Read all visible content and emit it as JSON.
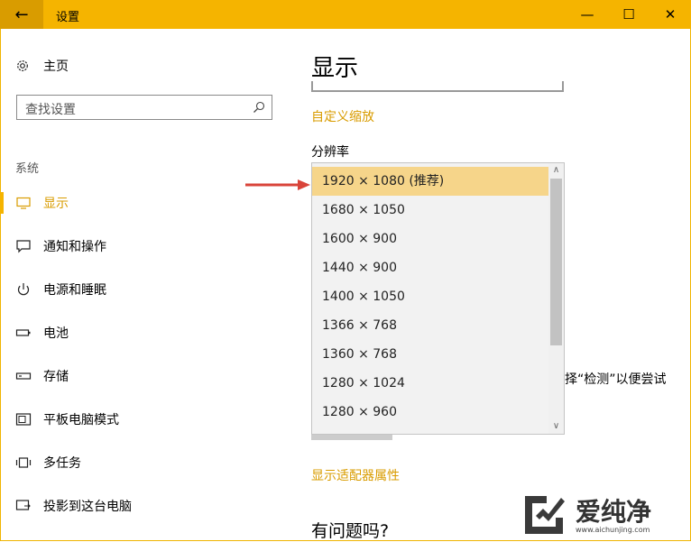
{
  "titlebar": {
    "title": "设置",
    "back": "←",
    "minimize": "—",
    "maximize": "☐",
    "close": "✕"
  },
  "sidebar": {
    "home": "主页",
    "search_placeholder": "查找设置",
    "section": "系统",
    "items": [
      {
        "label": "显示",
        "icon": "monitor-icon",
        "active": true
      },
      {
        "label": "通知和操作",
        "icon": "notification-icon"
      },
      {
        "label": "电源和睡眠",
        "icon": "power-icon"
      },
      {
        "label": "电池",
        "icon": "battery-icon"
      },
      {
        "label": "存储",
        "icon": "storage-icon"
      },
      {
        "label": "平板电脑模式",
        "icon": "tablet-icon"
      },
      {
        "label": "多任务",
        "icon": "multitask-icon"
      },
      {
        "label": "投影到这台电脑",
        "icon": "project-icon"
      }
    ]
  },
  "main": {
    "title": "显示",
    "custom_scaling_link": "自定义缩放",
    "resolution_label": "分辨率",
    "resolution_options": [
      "1920 × 1080 (推荐)",
      "1680 × 1050",
      "1600 × 900",
      "1440 × 900",
      "1400 × 1050",
      "1366 × 768",
      "1360 × 768",
      "1280 × 1024",
      "1280 × 960"
    ],
    "selected_index": 0,
    "partial_text": "择“检测”以便尝试",
    "adapter_link": "显示适配器属性",
    "question_heading": "有问题吗?"
  },
  "watermark": {
    "brand": "爱纯净",
    "url": "www.aichunjing.com"
  },
  "colors": {
    "accent": "#f5b400",
    "link": "#d99c00",
    "selected": "#f6d58a",
    "arrow": "#d9443a"
  }
}
